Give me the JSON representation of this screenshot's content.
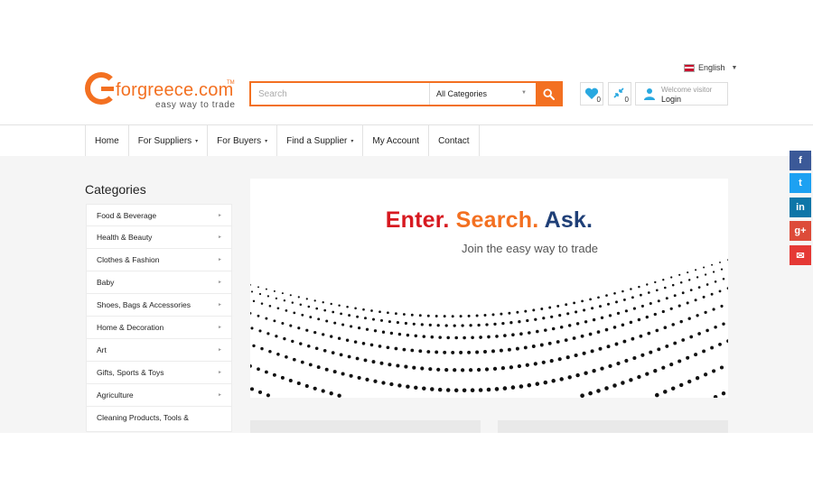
{
  "header": {
    "language": "English",
    "logo_text": "Gforgreece.com",
    "logo_text_rest": "forgreece.com",
    "logo_tm": "TM",
    "logo_tagline": "easy way to trade",
    "search_placeholder": "Search",
    "category_select": "All Categories",
    "wishlist_count": "0",
    "compare_count": "0",
    "welcome_text": "Welcome visitor",
    "login_label": "Login"
  },
  "nav": {
    "items": [
      {
        "label": "Home"
      },
      {
        "label": "For Suppliers"
      },
      {
        "label": "For Buyers"
      },
      {
        "label": "Find a Supplier"
      },
      {
        "label": "My Account"
      },
      {
        "label": "Contact"
      }
    ],
    "dropdown_arrow": "▾"
  },
  "sidebar": {
    "title": "Categories",
    "items": [
      {
        "label": "Food & Beverage"
      },
      {
        "label": "Health & Beauty"
      },
      {
        "label": "Clothes & Fashion"
      },
      {
        "label": "Baby"
      },
      {
        "label": "Shoes, Bags & Accessories"
      },
      {
        "label": "Home & Decoration"
      },
      {
        "label": "Art"
      },
      {
        "label": "Gifts, Sports & Toys"
      },
      {
        "label": "Agriculture"
      },
      {
        "label": "Cleaning Products, Tools &"
      }
    ],
    "arrow": "►"
  },
  "hero": {
    "word1": "Enter.",
    "word2": "Search.",
    "word3": "Ask.",
    "subtitle": "Join the easy way to trade"
  },
  "social": {
    "facebook": "f",
    "twitter": "t",
    "linkedin": "in",
    "googleplus": "g+",
    "email": "✉"
  },
  "colors": {
    "brand_orange": "#f37021",
    "headline_red": "#d71920",
    "headline_navy": "#1f3f77",
    "facebook": "#3b5998",
    "twitter": "#1da1f2",
    "linkedin": "#0e76a8",
    "googleplus": "#dd4b39",
    "email": "#e53935"
  }
}
